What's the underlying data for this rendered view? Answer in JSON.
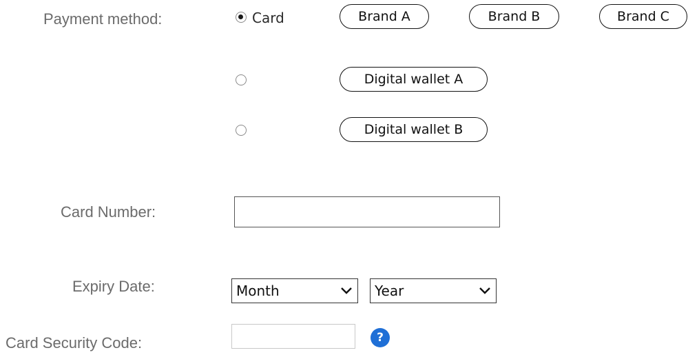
{
  "payment": {
    "label": "Payment method:",
    "card_label": "Card",
    "brands": [
      "Brand A",
      "Brand B",
      "Brand C"
    ],
    "wallet_a": "Digital wallet A",
    "wallet_b": "Digital wallet B",
    "selected": "card"
  },
  "card_number": {
    "label": "Card Number:",
    "value": ""
  },
  "expiry": {
    "label": "Expiry Date:",
    "month_selected": "Month",
    "year_selected": "Year"
  },
  "security": {
    "label": "Card Security Code:",
    "value": "",
    "help_glyph": "?"
  },
  "colors": {
    "help_icon": "#1f6fd6",
    "label_text": "#6b6b6b"
  }
}
